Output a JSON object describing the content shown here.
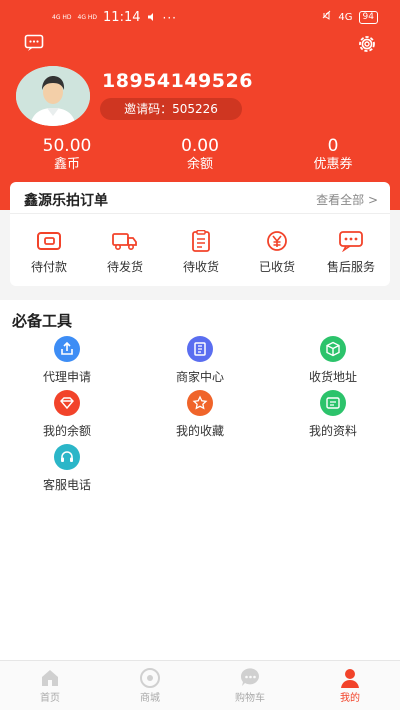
{
  "status_bar": {
    "signal1": "4G HD",
    "signal2": "4G HD",
    "time": "11:14",
    "dots": "···",
    "battery": "94",
    "right_signal": "4G"
  },
  "header": {
    "phone": "18954149526",
    "invite": "邀请码：505226",
    "stats": [
      {
        "value": "50.00",
        "label": "鑫币"
      },
      {
        "value": "0.00",
        "label": "余额"
      },
      {
        "value": "0",
        "label": "优惠券"
      }
    ]
  },
  "orders": {
    "title": "鑫源乐拍订单",
    "view_all": "查看全部 >",
    "items": [
      {
        "label": "待付款",
        "icon": "wallet-icon"
      },
      {
        "label": "待发货",
        "icon": "truck-icon"
      },
      {
        "label": "待收货",
        "icon": "clipboard-icon"
      },
      {
        "label": "已收货",
        "icon": "yen-icon"
      },
      {
        "label": "售后服务",
        "icon": "chat-icon"
      }
    ]
  },
  "tools": {
    "title": "必备工具",
    "items": [
      {
        "label": "代理申请",
        "icon": "upload-icon",
        "color": "#3d8df5"
      },
      {
        "label": "商家中心",
        "icon": "book-icon",
        "color": "#5a6ef0"
      },
      {
        "label": "收货地址",
        "icon": "box-icon",
        "color": "#2cc36b"
      },
      {
        "label": "我的余额",
        "icon": "diamond-icon",
        "color": "#f2432a"
      },
      {
        "label": "我的收藏",
        "icon": "star-icon",
        "color": "#f0642a"
      },
      {
        "label": "我的资料",
        "icon": "profile-icon",
        "color": "#2cc36b"
      },
      {
        "label": "客服电话",
        "icon": "headset-icon",
        "color": "#2bb6c8"
      }
    ]
  },
  "tabbar": {
    "tabs": [
      {
        "label": "首页",
        "icon": "home-icon"
      },
      {
        "label": "商城",
        "icon": "shop-icon"
      },
      {
        "label": "购物车",
        "icon": "cart-icon"
      },
      {
        "label": "我的",
        "icon": "user-icon"
      }
    ],
    "active": "我的"
  },
  "colors": {
    "primary": "#f2432a",
    "tab_inactive": "#aaaaaa"
  }
}
